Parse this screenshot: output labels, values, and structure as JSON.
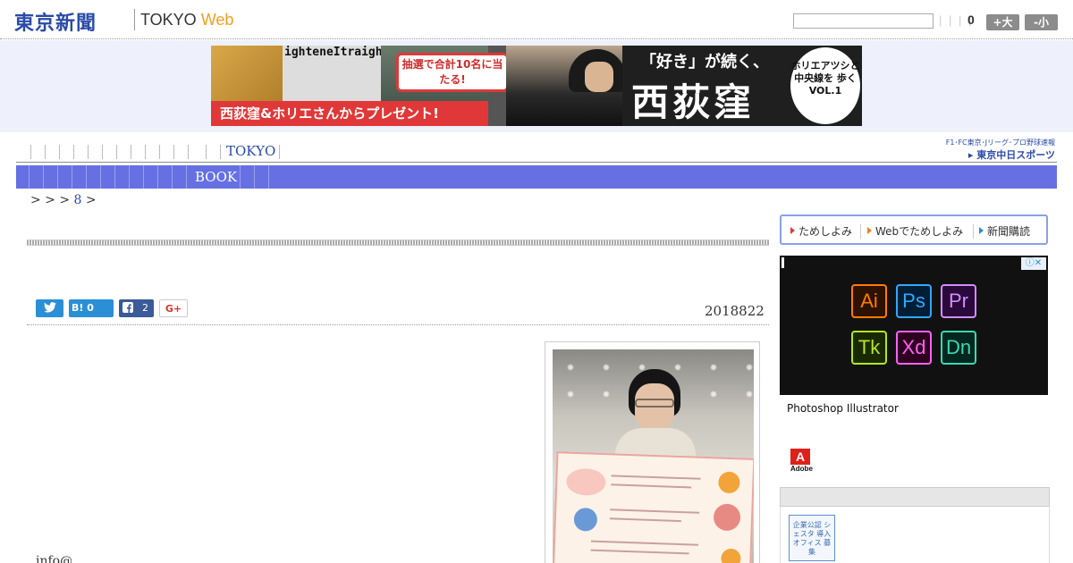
{
  "header": {
    "logo_main": "東京新聞",
    "logo_tokyo": "TOKYO ",
    "logo_web": "Web",
    "search": {
      "value": "",
      "placeholder": ""
    },
    "font_bars": "| | | |",
    "font_size_value": "0",
    "btn_large": "+大",
    "btn_small": "-小"
  },
  "banner": {
    "letters": "ighteneItraighteIghteneristraight",
    "bubble": "抽選で合計10名に当たる!",
    "red_bar": "西荻窪&ホリエさんからプレゼント!",
    "quote": "「好き」が続く、",
    "big": "西荻窪",
    "circle": "ホリエアツシと 中央線を 歩く VOL.1"
  },
  "nav": {
    "tokyo_label": "TOKYO",
    "book_label": "BOOK",
    "chunichi_small": "F1･FC東京･Jリーグ･プロ野球速報",
    "chunichi_big": "▸ 東京中日スポーツ"
  },
  "breadcrumb": {
    "prefix": "> > > ",
    "link": "8",
    "suffix": " >"
  },
  "article": {
    "date": "2018822",
    "email_partial": "info@",
    "share": {
      "twitter_icon": "twitter-bird-icon",
      "hatena_label": "B! 0",
      "facebook_count": "2",
      "googleplus_label": "G+"
    }
  },
  "sidebar": {
    "tame": [
      {
        "label": "ためしよみ",
        "color": "#e03838"
      },
      {
        "label": "Webでためしよみ",
        "color": "#f08020"
      },
      {
        "label": "新聞購読",
        "color": "#2b8fd6"
      }
    ],
    "adobe_tiles": [
      {
        "label": "Ai",
        "color": "#ff7c00"
      },
      {
        "label": "Ps",
        "color": "#31a8ff"
      },
      {
        "label": "Pr",
        "color": "#d48cff"
      },
      {
        "label": "Tk",
        "color": "#b5e61d"
      },
      {
        "label": "Xd",
        "color": "#ff61f6"
      },
      {
        "label": "Dn",
        "color": "#3ad8b4"
      }
    ],
    "adobe_text": "Photoshop  Illustrator",
    "adobe_logo": "A",
    "adobe_brand": "Adobe",
    "promo_badge": "企業公認 シェスタ 導入オフィス 募集"
  }
}
